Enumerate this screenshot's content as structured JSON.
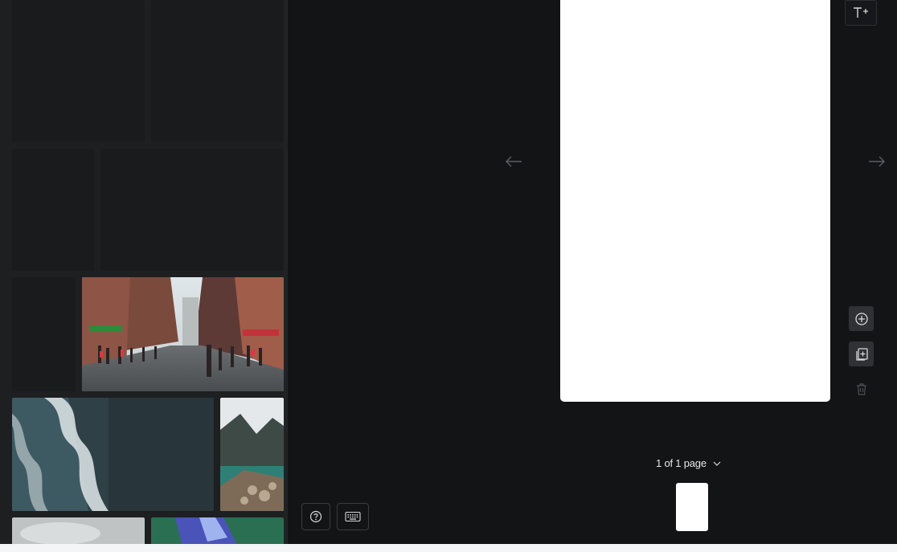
{
  "page_indicator": {
    "label": "1 of 1 page"
  },
  "colors": {
    "background": "#131416",
    "panel": "#1d1f21",
    "page": "#ffffff"
  },
  "icons": {
    "add_text": "text-plus-icon",
    "add_page": "circle-plus-icon",
    "duplicate_page": "duplicate-page-icon",
    "delete_page": "trash-icon",
    "prev": "arrow-left-icon",
    "next": "arrow-right-icon",
    "help": "help-circle-icon",
    "keyboard": "keyboard-icon"
  }
}
